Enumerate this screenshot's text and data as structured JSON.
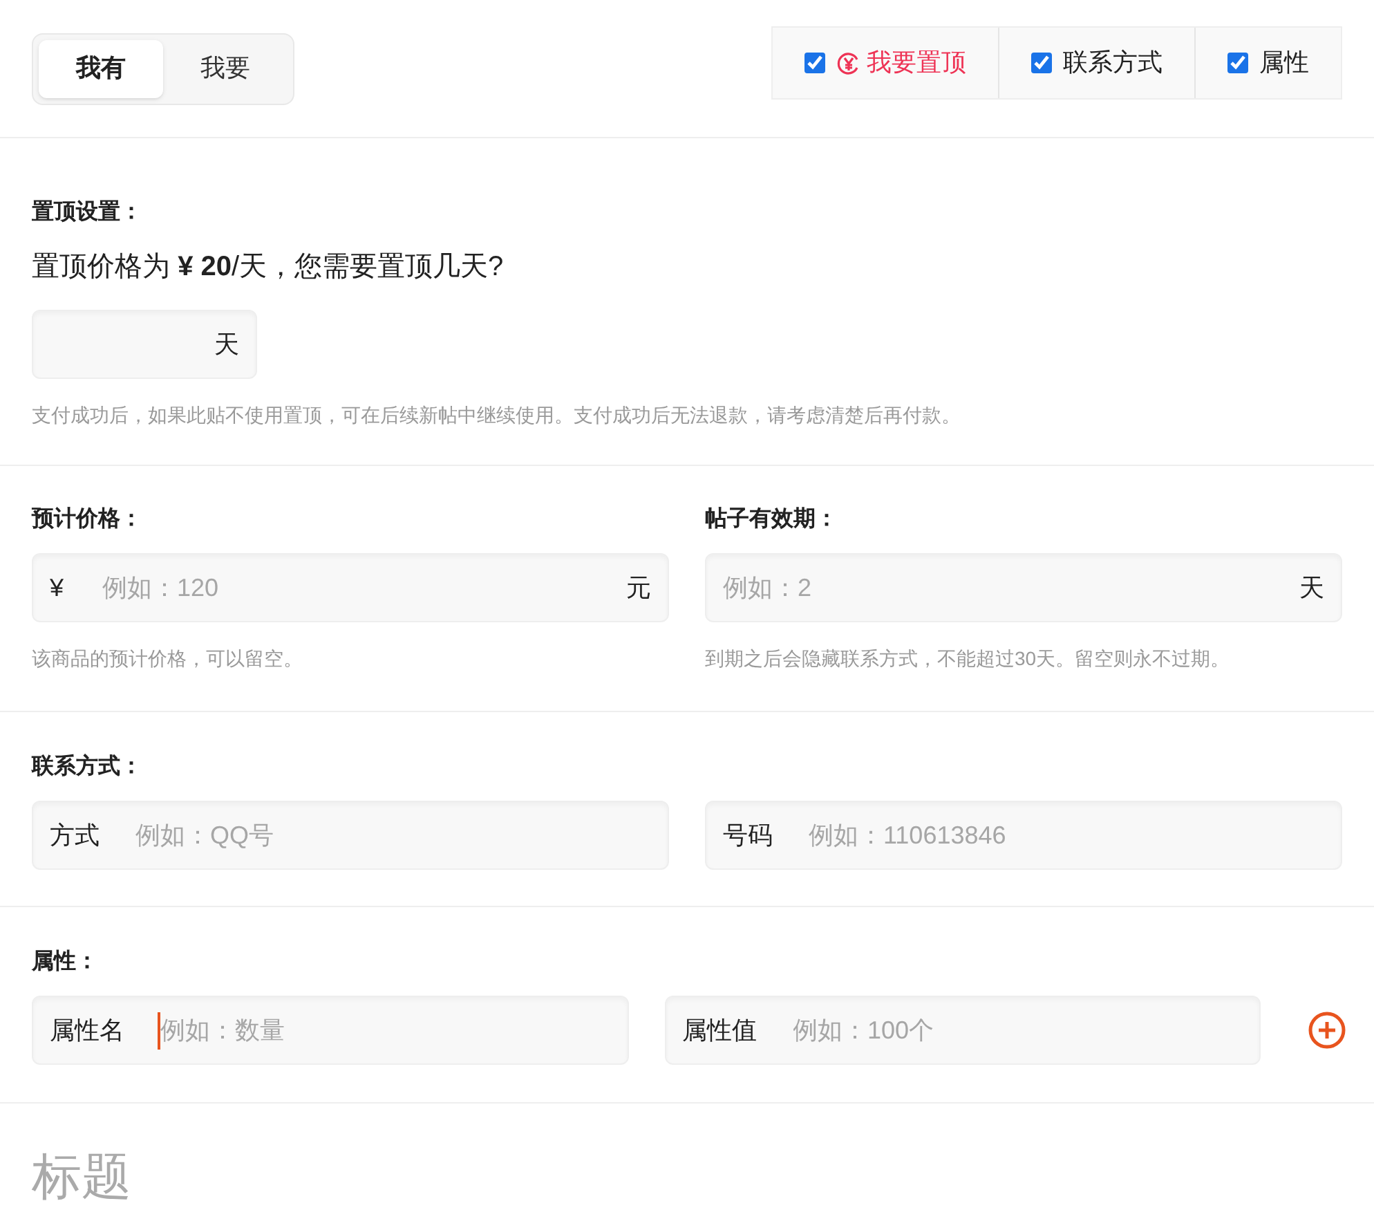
{
  "mode_tabs": [
    {
      "label": "我有",
      "selected": true
    },
    {
      "label": "我要",
      "selected": false
    }
  ],
  "options": [
    {
      "label": "我要置顶",
      "checked": true,
      "kind": "paid"
    },
    {
      "label": "联系方式",
      "checked": true,
      "kind": "plain"
    },
    {
      "label": "属性",
      "checked": true,
      "kind": "plain"
    }
  ],
  "pin": {
    "heading": "置顶设置：",
    "question": "置顶价格为 **¥ 20**/天，您需要置顶几天?",
    "unit": "天",
    "note": "支付成功后，如果此贴不使用置顶，可在后续新帖中继续使用。支付成功后无法退款，请考虑清楚后再付款。"
  },
  "price": {
    "heading": "预计价格：",
    "prefix": "¥",
    "placeholder": "例如：120",
    "unit": "元",
    "note": "该商品的预计价格，可以留空。"
  },
  "validity": {
    "heading": "帖子有效期：",
    "placeholder": "例如：2",
    "unit": "天",
    "note": "到期之后会隐藏联系方式，不能超过30天。留空则永不过期。"
  },
  "contact": {
    "heading": "联系方式：",
    "fields": [
      {
        "label": "方式",
        "placeholder": "例如：QQ号"
      },
      {
        "label": "号码",
        "placeholder": "例如：110613846"
      }
    ]
  },
  "attributes": {
    "heading": "属性：",
    "fields": [
      {
        "label": "属性名",
        "placeholder": "例如：数量",
        "focused": true
      },
      {
        "label": "属性值",
        "placeholder": "例如：100个",
        "focused": false
      }
    ]
  },
  "title": {
    "placeholder": "标题"
  }
}
